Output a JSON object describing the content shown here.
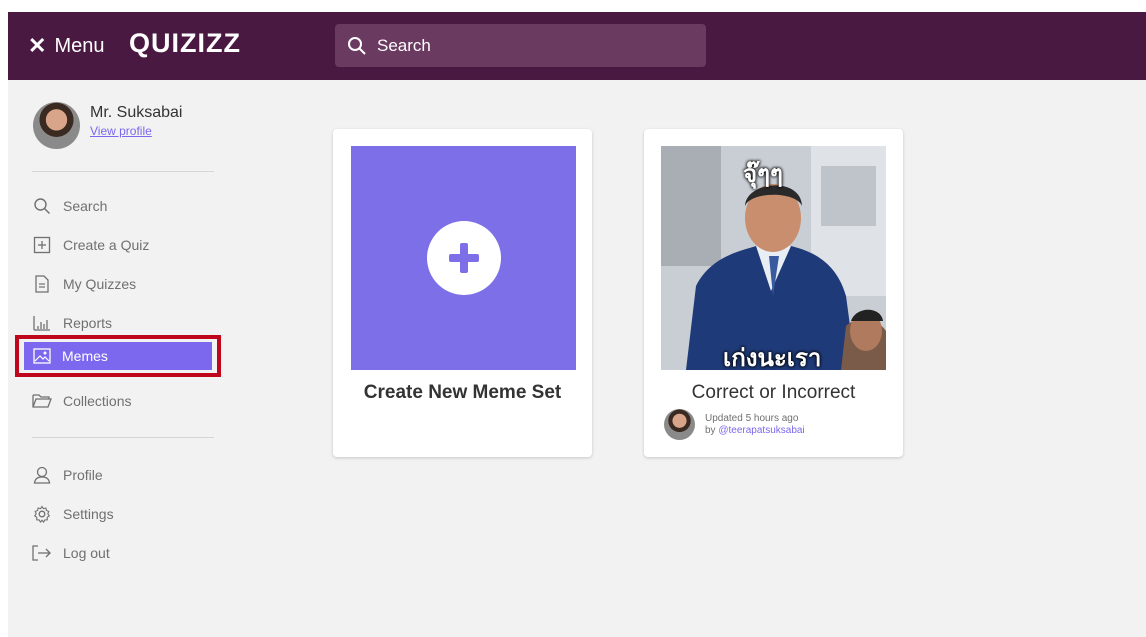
{
  "topbar": {
    "menu_label": "Menu",
    "logo_text": "QUIZIZZ",
    "search_placeholder": "Search",
    "bg_color": "#4a1942"
  },
  "sidebar": {
    "profile": {
      "name": "Mr. Suksabai",
      "view_profile": "View profile"
    },
    "main_items": [
      {
        "label": "Search",
        "icon": "search-icon"
      },
      {
        "label": "Create a Quiz",
        "icon": "plus-square-icon"
      },
      {
        "label": "My Quizzes",
        "icon": "document-icon"
      },
      {
        "label": "Reports",
        "icon": "bar-chart-icon"
      },
      {
        "label": "Memes",
        "icon": "image-icon",
        "active": true
      },
      {
        "label": "Collections",
        "icon": "folder-icon"
      }
    ],
    "secondary_items": [
      {
        "label": "Profile",
        "icon": "user-icon"
      },
      {
        "label": "Settings",
        "icon": "gear-icon"
      },
      {
        "label": "Log out",
        "icon": "logout-icon"
      }
    ],
    "accent_color": "#7b68ee",
    "highlight_color": "#c0061c"
  },
  "cards": {
    "create": {
      "title": "Create New Meme Set"
    },
    "meme_set": {
      "title": "Correct or Incorrect",
      "updated": "Updated 5 hours ago",
      "by_prefix": "by",
      "username": "@teerapatsuksabai",
      "image_top_text": "จุ๊ๆๆ",
      "image_bottom_text": "เก่งนะเรา"
    }
  }
}
